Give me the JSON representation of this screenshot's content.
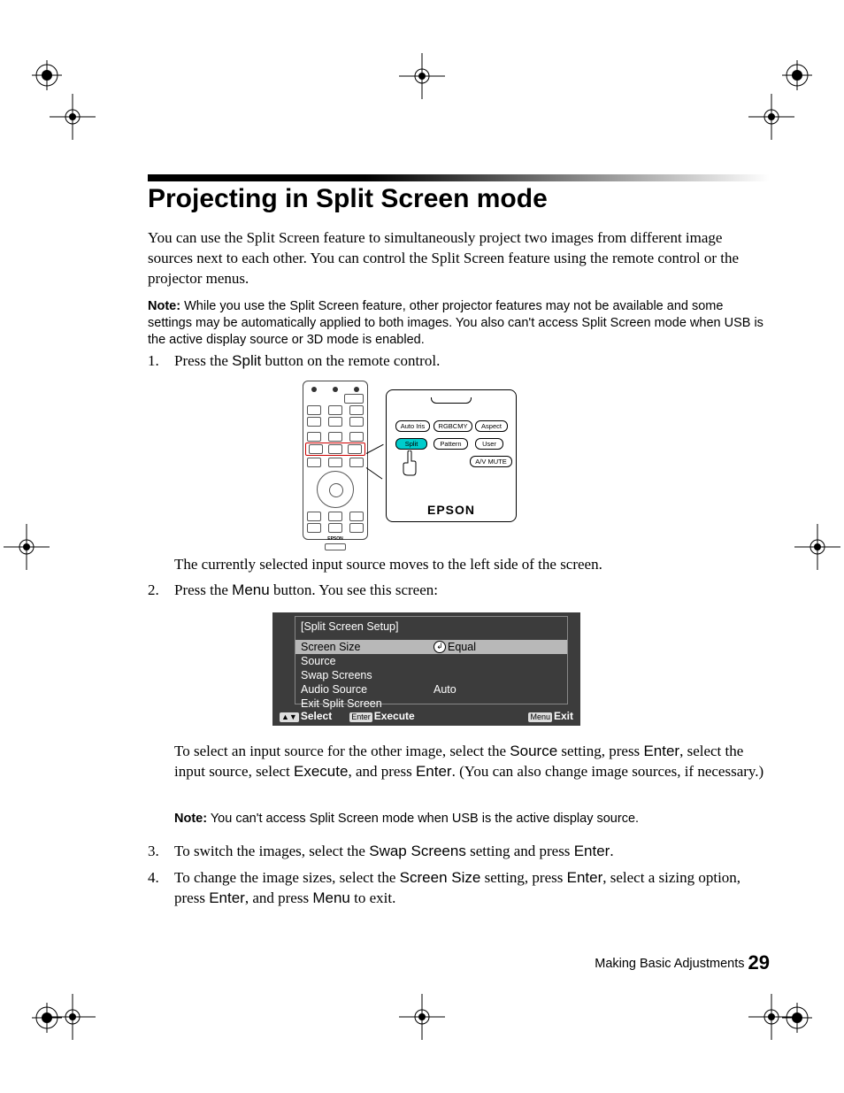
{
  "heading": "Projecting in Split Screen mode",
  "intro": "You can use the Split Screen feature to simultaneously project two images from different image sources next to each other. You can control the Split Screen feature using the remote control or the projector menus.",
  "note1_label": "Note:",
  "note1_text": " While you use the Split Screen feature, other projector features may not be available and some settings may be automatically applied to both images. You also can't access Split Screen mode when USB is the active display source or 3D mode is enabled.",
  "step1_num": "1.",
  "step1_a": "Press the ",
  "step1_b": "Split",
  "step1_c": " button on the remote control.",
  "remote_buttons": {
    "auto_iris": "Auto Iris",
    "rgbcmy": "RGBCMY",
    "aspect": "Aspect",
    "split": "Split",
    "pattern": "Pattern",
    "user": "User",
    "av_mute": "A/V MUTE",
    "logo": "EPSON"
  },
  "after1": "The currently selected input source moves to the left side of the screen.",
  "step2_num": "2.",
  "step2_a": "Press the ",
  "step2_b": "Menu",
  "step2_c": " button. You see this screen:",
  "osd": {
    "title": "[Split Screen Setup]",
    "rows": [
      {
        "label": "Screen Size",
        "value": "Equal",
        "selected": true,
        "icon": true
      },
      {
        "label": "Source",
        "value": "",
        "selected": false
      },
      {
        "label": "Swap Screens",
        "value": "",
        "selected": false
      },
      {
        "label": "Audio Source",
        "value": "Auto",
        "selected": false
      },
      {
        "label": "Exit Split Screen",
        "value": "",
        "selected": false
      }
    ],
    "footer_select_icon": "▲▼",
    "footer_select": "Select",
    "footer_execute_pill": "Enter",
    "footer_execute": "Execute",
    "footer_exit_pill": "Menu",
    "footer_exit": "Exit"
  },
  "after2_a": "To select an input source for the other image, select the ",
  "after2_b": "Source",
  "after2_c": " setting, press ",
  "after2_d": "Enter",
  "after2_e": ", select the input source, select ",
  "after2_f": "Execute",
  "after2_g": ", and press ",
  "after2_h": "Enter",
  "after2_i": ". (You can also change image sources, if necessary.)",
  "note2_label": "Note:",
  "note2_text": " You can't access Split Screen mode when USB is the active display source.",
  "step3_num": "3.",
  "step3_a": "To switch the images, select the ",
  "step3_b": "Swap Screens",
  "step3_c": " setting and press ",
  "step3_d": "Enter",
  "step3_e": ".",
  "step4_num": "4.",
  "step4_a": "To change the image sizes, select the ",
  "step4_b": "Screen Size",
  "step4_c": " setting, press ",
  "step4_d": "Enter",
  "step4_e": ", select a sizing option, press ",
  "step4_f": "Enter",
  "step4_g": ", and press ",
  "step4_h": "Menu",
  "step4_i": " to exit.",
  "footer_text": "Making Basic Adjustments",
  "page_number": "29"
}
